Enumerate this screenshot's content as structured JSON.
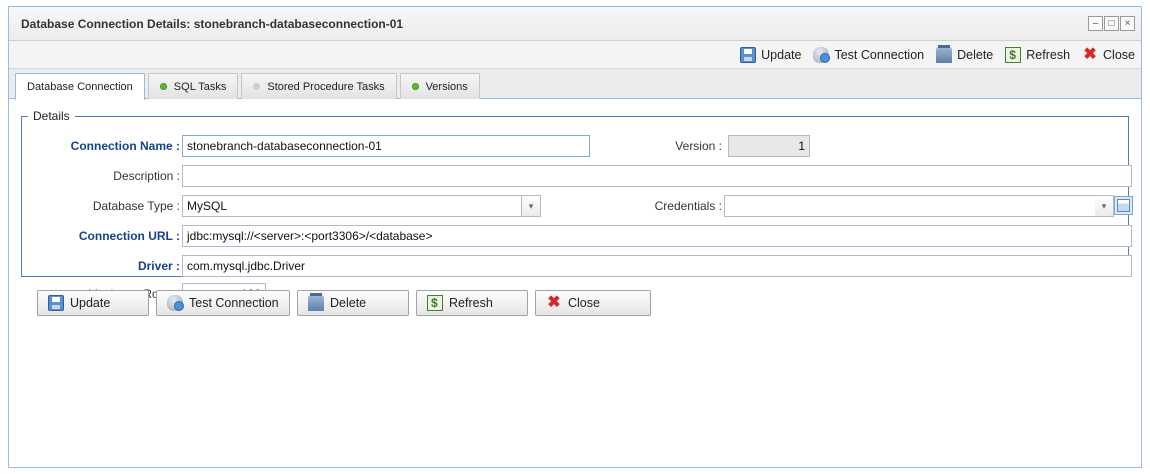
{
  "window": {
    "title": "Database Connection Details: stonebranch-databaseconnection-01",
    "controls": {
      "minimize": "–",
      "maximize": "□",
      "close": "×"
    }
  },
  "toolbar": {
    "update": "Update",
    "test_connection": "Test Connection",
    "delete": "Delete",
    "refresh": "Refresh",
    "close": "Close"
  },
  "tabs": [
    {
      "label": "Database Connection",
      "dot": "",
      "active": true
    },
    {
      "label": "SQL Tasks",
      "dot": "green"
    },
    {
      "label": "Stored Procedure Tasks",
      "dot": "grey"
    },
    {
      "label": "Versions",
      "dot": "green"
    }
  ],
  "details": {
    "legend": "Details",
    "connection_name": {
      "label": "Connection Name :",
      "value": "stonebranch-databaseconnection-01"
    },
    "version": {
      "label": "Version :",
      "value": "1"
    },
    "description": {
      "label": "Description :",
      "value": ""
    },
    "database_type": {
      "label": "Database Type :",
      "value": "MySQL"
    },
    "credentials": {
      "label": "Credentials :",
      "value": ""
    },
    "connection_url": {
      "label": "Connection URL :",
      "value": "jdbc:mysql://<server>:<port3306>/<database>"
    },
    "driver": {
      "label": "Driver :",
      "value": "com.mysql.jdbc.Driver"
    },
    "maximum_rows": {
      "label": "Maximum Rows :",
      "value": "100"
    }
  },
  "buttons": {
    "update": "Update",
    "test_connection": "Test Connection",
    "delete": "Delete",
    "refresh": "Refresh",
    "close": "Close"
  },
  "icons": {
    "update": "save-icon",
    "test_connection": "database-icon",
    "delete": "delete-icon",
    "refresh": "refresh-icon",
    "close": "close-icon",
    "credentials_lookup": "lookup-icon"
  },
  "colors": {
    "required_label": "#15428b",
    "fieldset_border": "#4f7fc0",
    "tab_dot_green": "#5cb82e"
  }
}
